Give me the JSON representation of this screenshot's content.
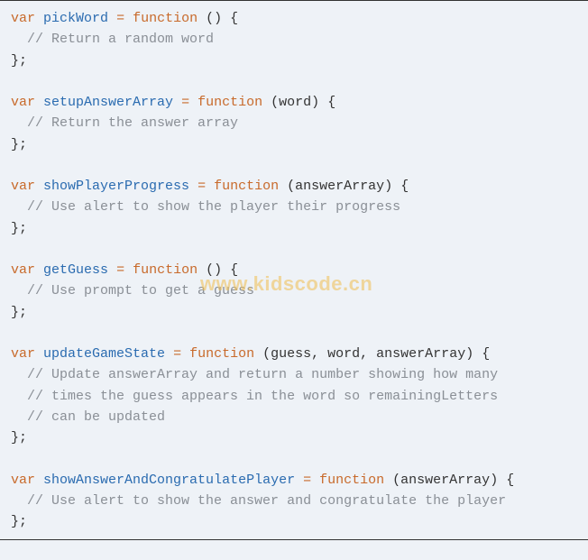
{
  "watermark": "www.kidscode.cn",
  "tokens": {
    "var": "var",
    "function": "function",
    "eq": "="
  },
  "blocks": [
    {
      "name": "pickWord",
      "params": "",
      "comments": [
        "// Return a random word"
      ]
    },
    {
      "name": "setupAnswerArray",
      "params": "word",
      "comments": [
        "// Return the answer array"
      ]
    },
    {
      "name": "showPlayerProgress",
      "params": "answerArray",
      "comments": [
        "// Use alert to show the player their progress"
      ]
    },
    {
      "name": "getGuess",
      "params": "",
      "comments": [
        "// Use prompt to get a guess"
      ]
    },
    {
      "name": "updateGameState",
      "params": "guess, word, answerArray",
      "comments": [
        "// Update answerArray and return a number showing how many",
        "// times the guess appears in the word so remainingLetters",
        "// can be updated"
      ]
    },
    {
      "name": "showAnswerAndCongratulatePlayer",
      "params": "answerArray",
      "comments": [
        "// Use alert to show the answer and congratulate the player"
      ]
    }
  ]
}
